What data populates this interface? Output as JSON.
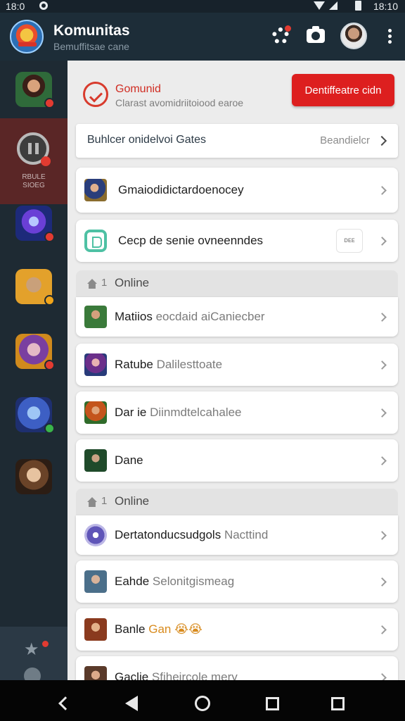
{
  "status_bar": {
    "time_left": "18:0",
    "time_right": "18:10"
  },
  "header": {
    "title": "Komunitas",
    "subtitle": "Bemuffitsae cane"
  },
  "sidebar": {
    "selected_label_line1": "RBULE",
    "selected_label_line2": "SIOEG",
    "servers": [
      {
        "icon": "warrior-avatar-icon",
        "badge_color": "#e23b31"
      },
      {
        "icon": "pause-icon",
        "badge_color": "#e23b31"
      },
      {
        "icon": "wizard-avatar-icon",
        "badge_color": "#e23b31"
      },
      {
        "icon": "elf-avatar-icon",
        "badge_color": "#f2a51a"
      },
      {
        "icon": "sorceress-avatar-icon",
        "badge_color": "#e23b31"
      },
      {
        "icon": "mage-avatar-icon",
        "badge_color": "#3ab54a"
      },
      {
        "icon": "hero-avatar-icon",
        "badge_color": ""
      }
    ]
  },
  "banner": {
    "title": "Gomunid",
    "subtitle": "Clarast avomidriitoiood earoe",
    "button_label": "Dentiffeatre cidn"
  },
  "top_card": {
    "label": "Buhlcer onidelvoi Gates",
    "right_label": "Beandielcr"
  },
  "cards": [
    {
      "label": "Gmaiodidictardoenocey"
    },
    {
      "label": "Cecp de senie ovneenndes",
      "tag": "ᴅᴇᴇ"
    }
  ],
  "sections": [
    {
      "count": "1",
      "label": "Online",
      "rows": [
        {
          "name": "Matiios",
          "extra": "eocdaid aiCaniecber"
        },
        {
          "name": "Ratube",
          "extra": "Dalilesttoate"
        },
        {
          "name": "Dar ie",
          "extra": "Diinmdtelcahalee"
        },
        {
          "name": "Dane",
          "extra": ""
        }
      ]
    },
    {
      "count": "1",
      "label": "Online",
      "rows": [
        {
          "name": "Dertatonducsudgols",
          "extra": "Nacttind"
        },
        {
          "name": "Eahde",
          "extra": "Selonitgismeag"
        },
        {
          "name": "Banle",
          "extra": "Gan",
          "extra_emoji": "😭😭"
        },
        {
          "name": "Gaclie",
          "extra": "Sfiheircole mery"
        }
      ]
    }
  ],
  "colors": {
    "header_bg": "#1d2d38",
    "sidebar_bg": "#1e2a33",
    "accent_red": "#dd1f1f",
    "content_bg": "#ececec"
  }
}
